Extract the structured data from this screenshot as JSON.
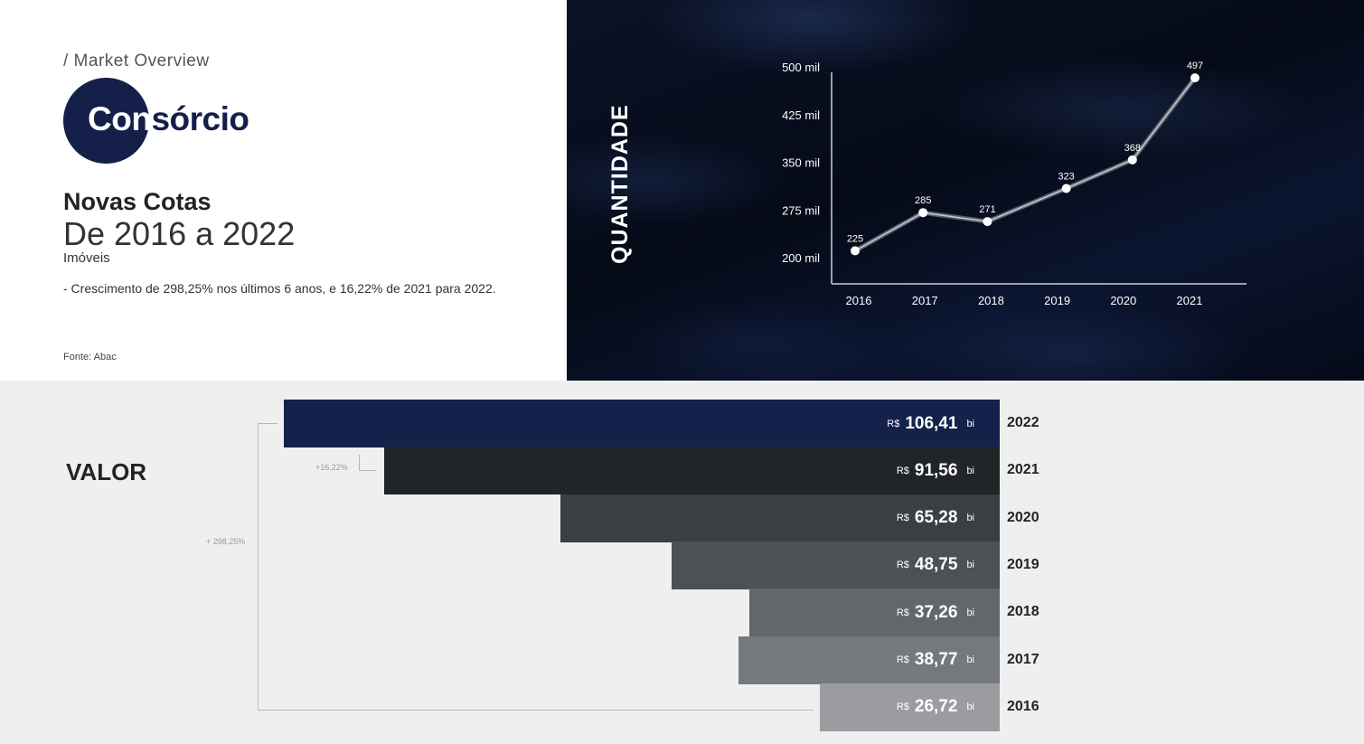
{
  "header": {
    "breadcrumb": "/ Market Overview",
    "brand_part1": "Con",
    "brand_part2": "sórcio",
    "title": "Novas Cotas",
    "subtitle": "De 2016 a 2022",
    "category": "Imóveis",
    "note": "- Crescimento de 298,25% nos últimos 6 anos, e 16,22% de 2021 para 2022.",
    "source": "Fonte: Abac"
  },
  "colors": {
    "brand_navy": "#142049",
    "bar_2022": "#13214b",
    "bar_2021": "#222528",
    "bar_2020": "#3b3e42",
    "bar_2019": "#4d5054",
    "bar_2018": "#63666a",
    "bar_2017": "#75787c",
    "bar_2016": "#9a9c9f"
  },
  "chart_data": [
    {
      "type": "line",
      "ylabel": "QUANTIDADE",
      "x": [
        "2016",
        "2017",
        "2018",
        "2019",
        "2020",
        "2021"
      ],
      "values": [
        225,
        285,
        271,
        323,
        368,
        497
      ],
      "value_labels": [
        "225",
        "285",
        "271",
        "323",
        "368",
        "497"
      ],
      "ylim": [
        200,
        500
      ],
      "y_ticks": [
        200,
        275,
        350,
        425,
        500
      ],
      "y_tick_labels": [
        "200 mil",
        "275 mil",
        "350 mil",
        "425 mil",
        "500 mil"
      ],
      "grid": false
    },
    {
      "type": "bar",
      "orientation": "horizontal",
      "title": "VALOR",
      "categories": [
        "2022",
        "2021",
        "2020",
        "2019",
        "2018",
        "2017",
        "2016"
      ],
      "values": [
        106.41,
        91.56,
        65.28,
        48.75,
        37.26,
        38.77,
        26.72
      ],
      "value_labels": [
        "106,41",
        "91,56",
        "65,28",
        "48,75",
        "37,26",
        "38,77",
        "26,72"
      ],
      "currency": "R$",
      "unit": "bi",
      "annotations": [
        "+16,22%",
        "+ 298,25%"
      ]
    }
  ]
}
